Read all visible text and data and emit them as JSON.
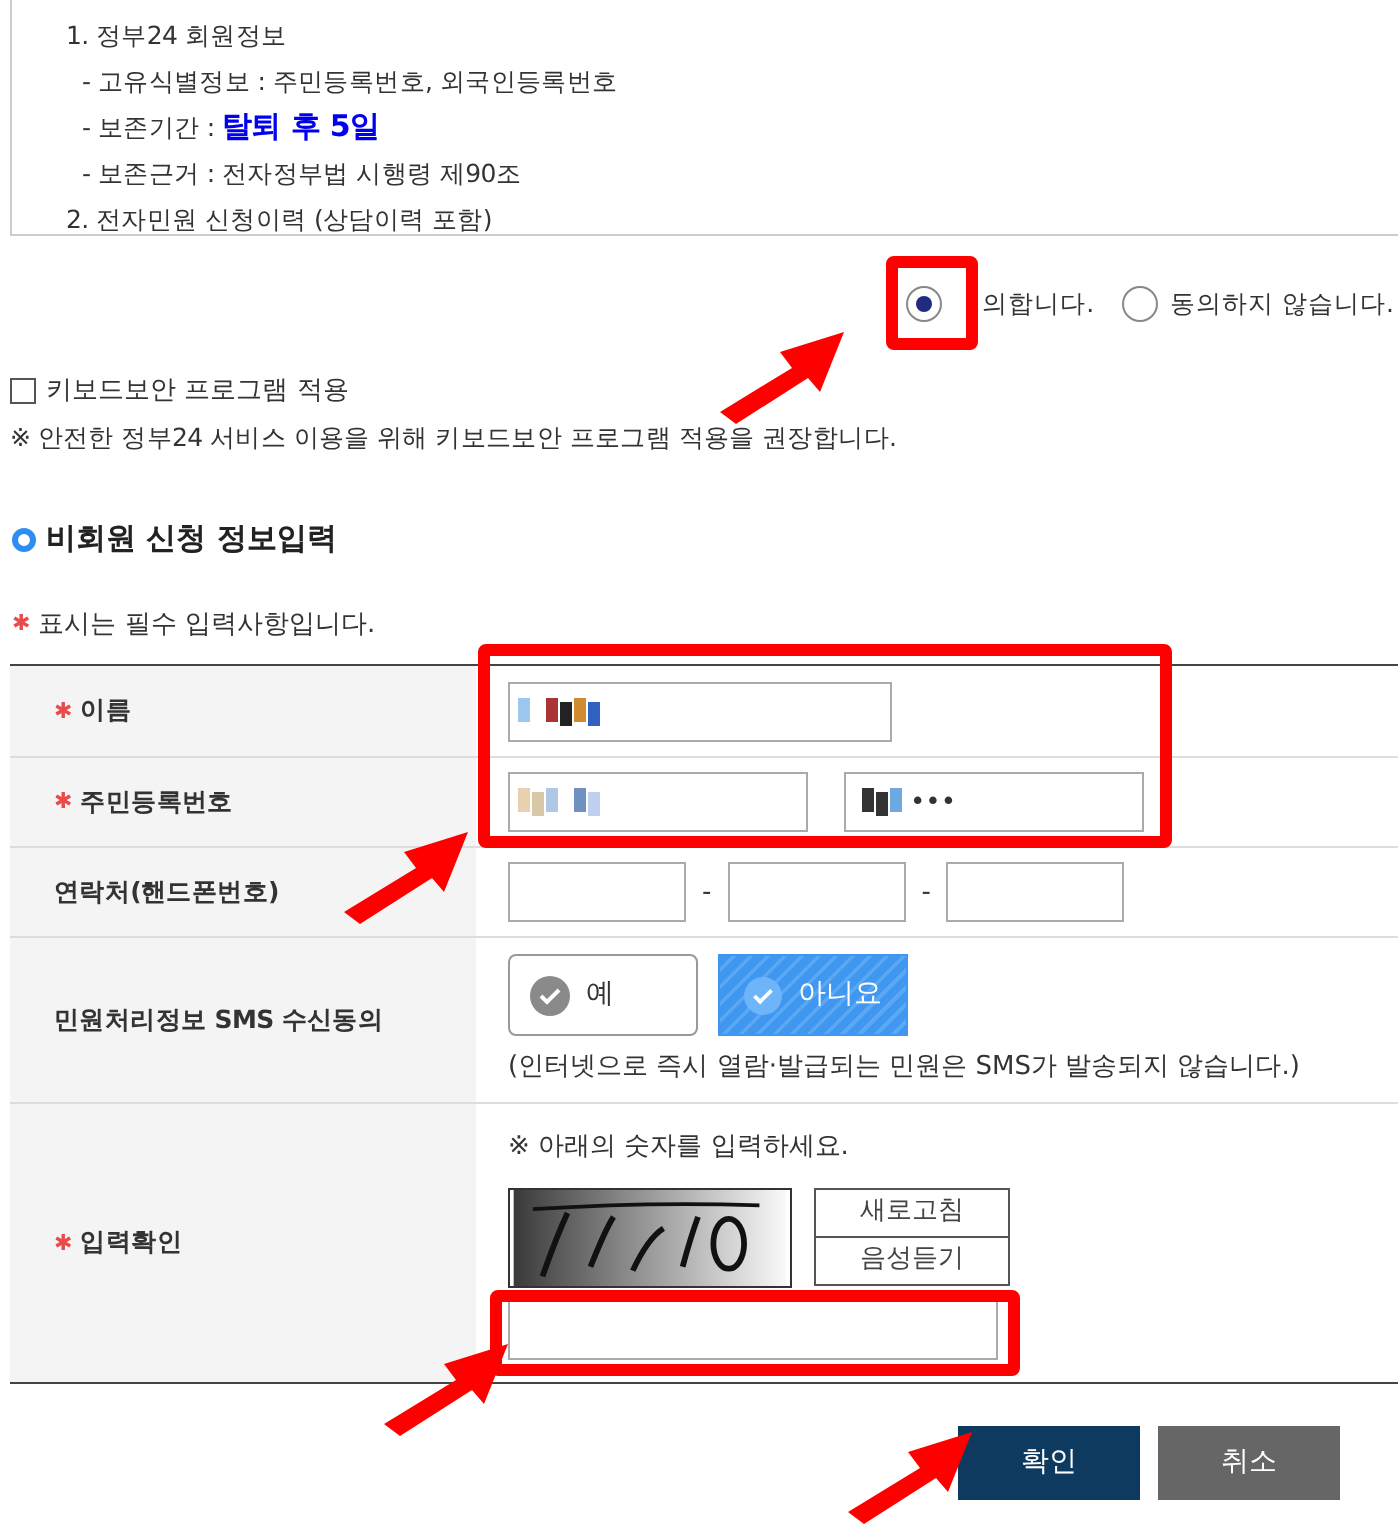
{
  "terms_box": {
    "lines": [
      {
        "kind": "heading",
        "text": "1. 정부24 회원정보"
      },
      {
        "kind": "item",
        "text": "- 고유식별정보 : 주민등록번호, 외국인등록번호"
      },
      {
        "kind": "item",
        "text": "- 보존기간 : **탈퇴 후 5일**"
      },
      {
        "kind": "item",
        "text": "- 보존근거 : 전자정부법 시행령 제90조"
      },
      {
        "kind": "heading",
        "text": "2. 전자민원 신청이력 (상담이력 포함)"
      }
    ]
  },
  "required_mark": "✱",
  "consent": [
    {
      "label": "의합니다.",
      "selected": true
    },
    {
      "label": "동의하지 않습니다.",
      "selected": false
    }
  ],
  "keyboard_security": {
    "label": "키보드보안 프로그램 적용",
    "checked": false,
    "note": "※ 안전한 정부24 서비스 이용을 위해 키보드보안 프로그램 적용을 권장합니다."
  },
  "section_title": "비회원 신청 정보입력",
  "required_note": "표시는 필수 입력사항입니다.",
  "form": {
    "rows": [
      {
        "kind": "name",
        "label": "이름",
        "required": true
      },
      {
        "kind": "rrn",
        "label": "주민등록번호",
        "required": true,
        "masked": "•••"
      },
      {
        "kind": "phone",
        "label": "연락처(핸드폰번호)",
        "required": false,
        "separator": "-"
      },
      {
        "kind": "sms",
        "label": "민원처리정보 SMS 수신동의",
        "required": false,
        "options": [
          {
            "label": "예",
            "selected": false
          },
          {
            "label": "아니요",
            "selected": true
          }
        ],
        "note": "(인터넷으로 즉시 열람·발급되는 민원은 SMS가 발송되지 않습니다.)"
      },
      {
        "kind": "captcha",
        "label": "입력확인",
        "required": true,
        "instruction": "※ 아래의 숫자를 입력하세요.",
        "buttons": [
          "새로고침",
          "음성듣기"
        ]
      }
    ]
  },
  "actions": [
    {
      "kind": "primary",
      "label": "확인"
    },
    {
      "kind": "secondary",
      "label": "취소"
    }
  ]
}
